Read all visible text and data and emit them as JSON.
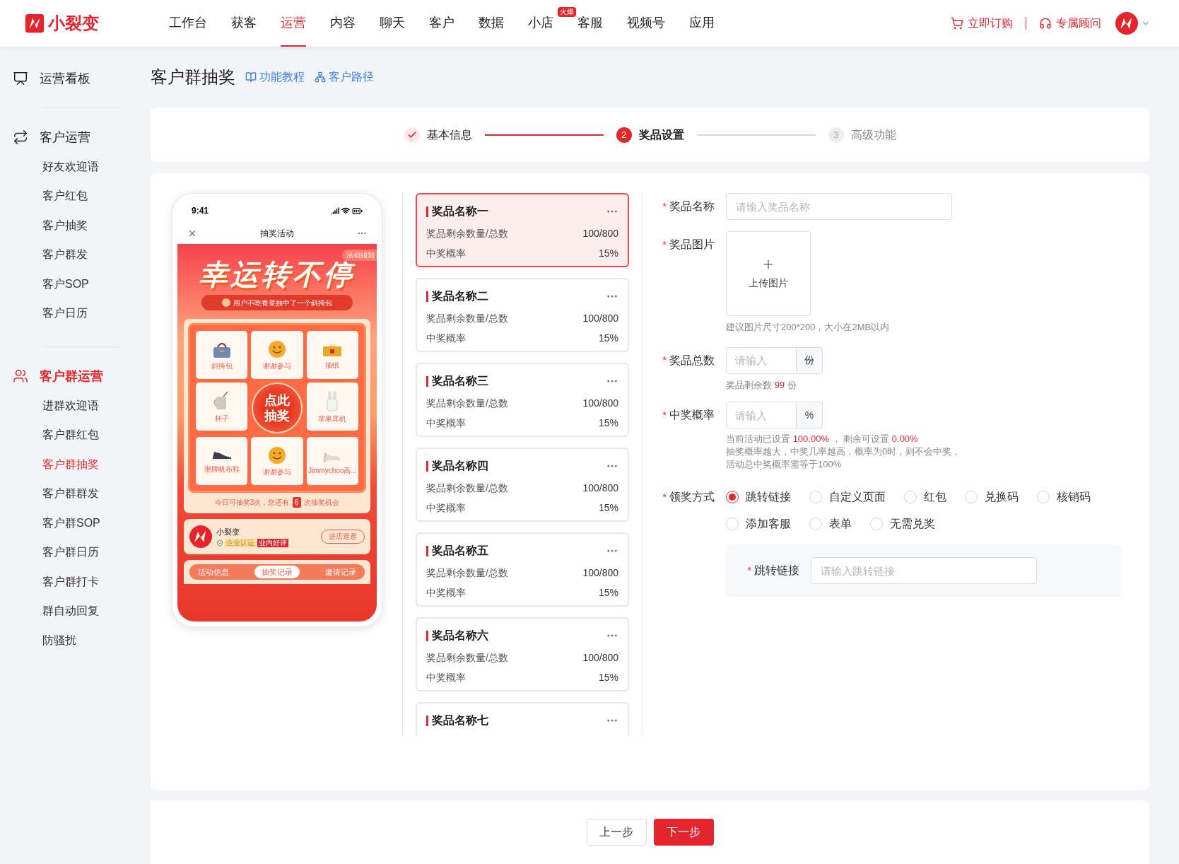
{
  "top_nav": {
    "logo": "小裂变",
    "items": [
      {
        "label": "工作台",
        "selected": false
      },
      {
        "label": "获客",
        "selected": false
      },
      {
        "label": "运营",
        "selected": true
      },
      {
        "label": "内容",
        "selected": false
      },
      {
        "label": "聊天",
        "selected": false
      },
      {
        "label": "客户",
        "selected": false
      },
      {
        "label": "数据",
        "selected": false
      },
      {
        "label": "小店",
        "selected": false,
        "badge": "火爆"
      },
      {
        "label": "客服",
        "selected": false
      },
      {
        "label": "视频号",
        "selected": false
      },
      {
        "label": "应用",
        "selected": false
      }
    ],
    "actions": [
      {
        "label": "立即订购",
        "kind": "cart"
      },
      {
        "label": "专属顾问",
        "kind": "headset"
      }
    ]
  },
  "sidebar": {
    "groups": [
      {
        "title": "运营看板",
        "kind": "board",
        "active": false
      },
      {
        "title": "客户运营",
        "kind": "exchange",
        "active": false,
        "items": [
          {
            "label": "好友欢迎语",
            "selected": false
          },
          {
            "label": "客户红包",
            "selected": false
          },
          {
            "label": "客户抽奖",
            "selected": false
          },
          {
            "label": "客户群发",
            "selected": false
          },
          {
            "label": "客户SOP",
            "selected": false
          },
          {
            "label": "客户日历",
            "selected": false
          }
        ]
      },
      {
        "title": "客户群运营",
        "kind": "users",
        "active": true,
        "items": [
          {
            "label": "进群欢迎语",
            "selected": false
          },
          {
            "label": "客户群红包",
            "selected": false
          },
          {
            "label": "客户群抽奖",
            "selected": true
          },
          {
            "label": "客户群群发",
            "selected": false
          },
          {
            "label": "客户群SOP",
            "selected": false
          },
          {
            "label": "客户群日历",
            "selected": false
          },
          {
            "label": "客户群打卡",
            "selected": false
          },
          {
            "label": "群自动回复",
            "selected": false
          },
          {
            "label": "防骚扰",
            "selected": false
          }
        ]
      }
    ]
  },
  "page": {
    "title": "客户群抽奖",
    "links": [
      {
        "label": "功能教程",
        "kind": "book"
      },
      {
        "label": "客户路径",
        "kind": "path"
      }
    ]
  },
  "steps": [
    {
      "label": "基本信息",
      "completed": true,
      "selected": false
    },
    {
      "number": "2",
      "label": "奖品设置",
      "completed": false,
      "selected": true
    },
    {
      "number": "3",
      "label": "高级功能",
      "completed": false,
      "selected": false
    }
  ],
  "phone": {
    "time": "9:41",
    "title": "抽奖活动",
    "notice": "活动须知",
    "headline": "幸运转不停",
    "ticker": "用户不吃香菜抽中了一个斜挎包",
    "grid": [
      {
        "label": "斜挎包",
        "kind": "bag"
      },
      {
        "label": "谢谢参与",
        "kind": "smile"
      },
      {
        "label": "抽纸",
        "kind": "tissue"
      },
      {
        "label": "杯子",
        "kind": "cup"
      },
      {
        "label": "苹果耳机",
        "kind": "earbuds"
      },
      {
        "label": "潮牌帆布鞋",
        "kind": "shoes"
      },
      {
        "label": "谢谢参与",
        "kind": "smile"
      },
      {
        "label": "Jimmychoo高...",
        "kind": "heels"
      }
    ],
    "draw_button": "点此抽奖",
    "chances": [
      {
        "text": "今日可抽奖3次，您还有 "
      },
      {
        "text": "6",
        "highlight": true
      },
      {
        "text": " 次抽奖机会"
      }
    ],
    "shop": {
      "name": "小裂变",
      "tags": [
        {
          "label": "企业认证",
          "kind": "verified"
        },
        {
          "label": "业内好评",
          "kind": "praise"
        }
      ],
      "button": "进店逛逛"
    },
    "tabs": [
      {
        "label": "活动信息",
        "selected": false
      },
      {
        "label": "抽奖记录",
        "selected": true
      },
      {
        "label": "邀请记录",
        "selected": false
      }
    ]
  },
  "prizes": [
    {
      "name": "奖品名称一",
      "selected": true,
      "stock_label": "奖品剩余数量/总数",
      "stock": "100/800",
      "rate_label": "中奖概率",
      "rate": "15%"
    },
    {
      "name": "奖品名称二",
      "selected": false,
      "stock_label": "奖品剩余数量/总数",
      "stock": "100/800",
      "rate_label": "中奖概率",
      "rate": "15%"
    },
    {
      "name": "奖品名称三",
      "selected": false,
      "stock_label": "奖品剩余数量/总数",
      "stock": "100/800",
      "rate_label": "中奖概率",
      "rate": "15%"
    },
    {
      "name": "奖品名称四",
      "selected": false,
      "stock_label": "奖品剩余数量/总数",
      "stock": "100/800",
      "rate_label": "中奖概率",
      "rate": "15%"
    },
    {
      "name": "奖品名称五",
      "selected": false,
      "stock_label": "奖品剩余数量/总数",
      "stock": "100/800",
      "rate_label": "中奖概率",
      "rate": "15%"
    },
    {
      "name": "奖品名称六",
      "selected": false,
      "stock_label": "奖品剩余数量/总数",
      "stock": "100/800",
      "rate_label": "中奖概率",
      "rate": "15%"
    },
    {
      "name": "奖品名称七",
      "selected": false
    }
  ],
  "form": {
    "required_mark": "*",
    "name": {
      "label": "奖品名称",
      "placeholder": "请输入奖品名称"
    },
    "image": {
      "label": "奖品图片",
      "upload": "上传图片",
      "hint": "建议图片尺寸200*200，大小在2MB以内"
    },
    "total": {
      "label": "奖品总数",
      "placeholder": "请输入",
      "unit": "份",
      "hint": [
        {
          "text": "奖品剩余数 "
        },
        {
          "text": "99",
          "highlight": true
        },
        {
          "text": " 份"
        }
      ]
    },
    "rate": {
      "label": "中奖概率",
      "placeholder": "请输入",
      "unit": "%",
      "hint": [
        {
          "text": "当前活动已设置 "
        },
        {
          "text": "100.00%",
          "highlight": true
        },
        {
          "text": " ， 剩余可设置 "
        },
        {
          "text": "0.00%",
          "highlight": true
        }
      ],
      "notes": [
        "抽奖概率越大，中奖几率越高，概率为0时，则不会中奖，",
        "活动总中奖概率需等于100%"
      ]
    },
    "method": {
      "label": "领奖方式",
      "options": [
        {
          "label": "跳转链接",
          "selected": true
        },
        {
          "label": "自定义页面",
          "selected": false
        },
        {
          "label": "红包",
          "selected": false
        },
        {
          "label": "兑换码",
          "selected": false
        },
        {
          "label": "核销码",
          "selected": false
        },
        {
          "label": "添加客服",
          "selected": false
        },
        {
          "label": "表单",
          "selected": false
        },
        {
          "label": "无需兑奖",
          "selected": false
        }
      ],
      "detail": {
        "label": "跳转链接",
        "placeholder": "请输入跳转链接"
      }
    }
  },
  "footer_buttons": [
    {
      "label": "上一步",
      "kind": "secondary"
    },
    {
      "label": "下一步",
      "kind": "primary"
    }
  ]
}
